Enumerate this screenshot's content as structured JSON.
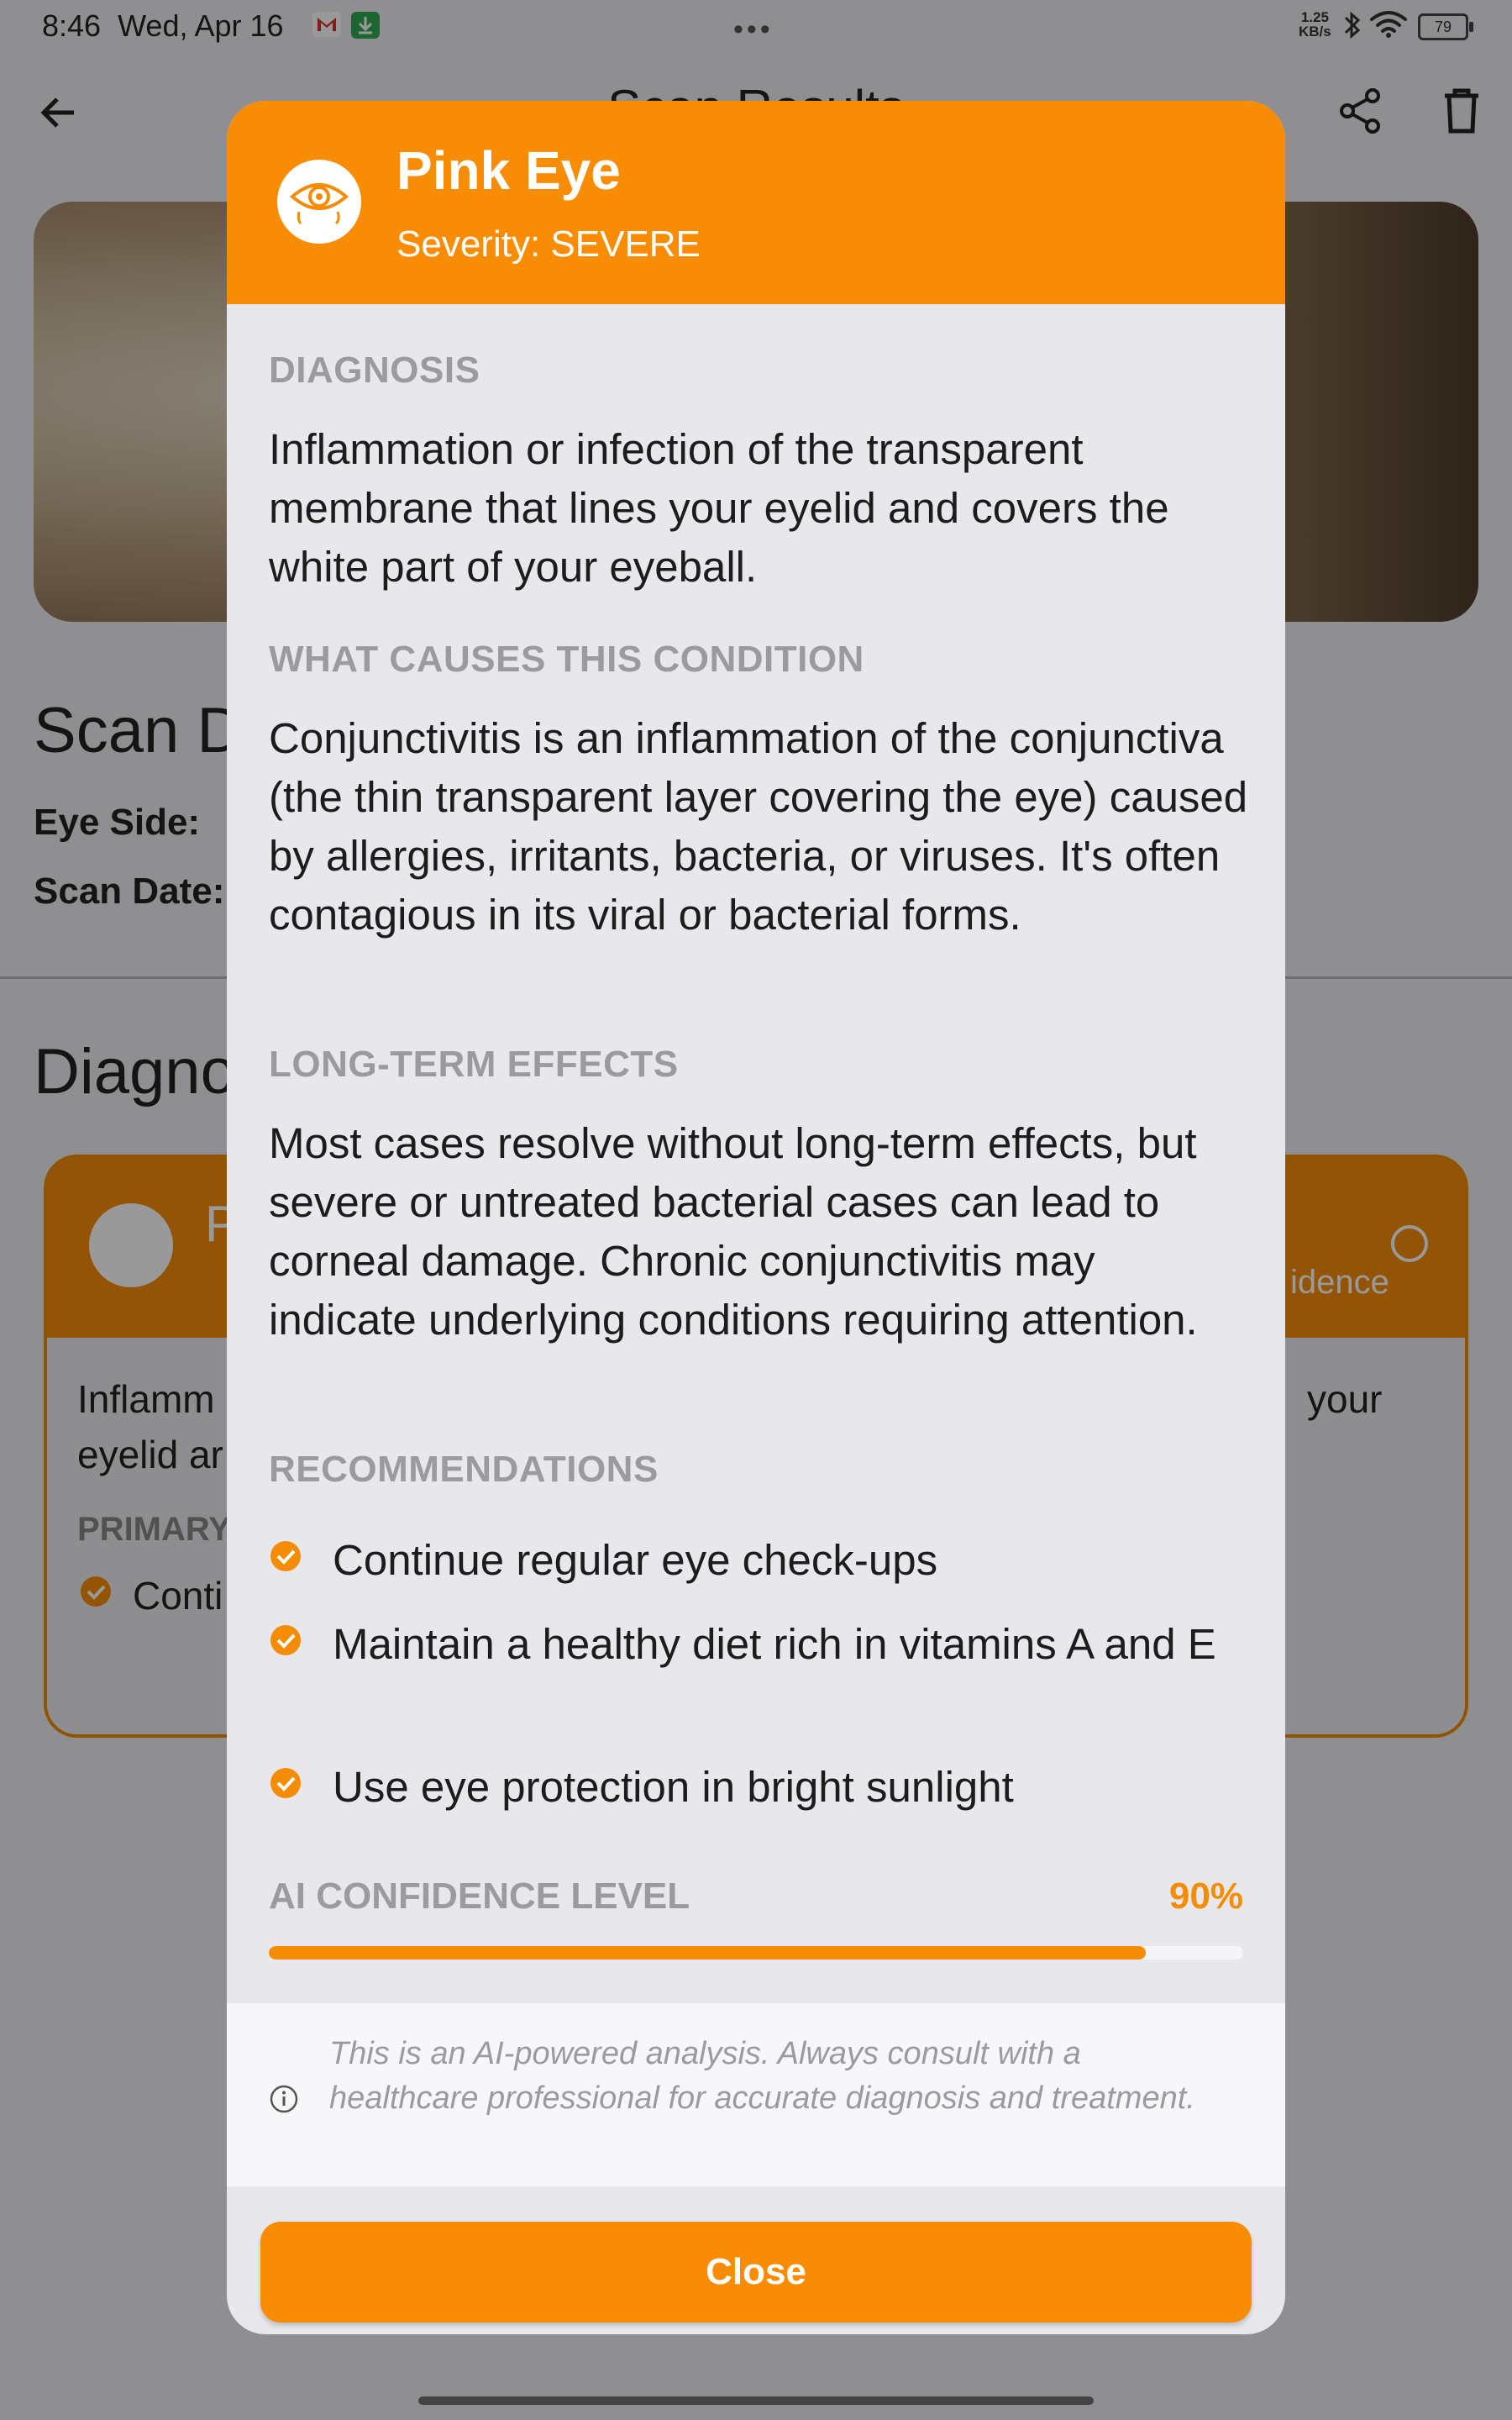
{
  "status_bar": {
    "time": "8:46",
    "date": "Wed, Apr 16",
    "network_speed_value": "1.25",
    "network_speed_unit": "KB/s",
    "battery": "79",
    "icons": [
      "gmail-icon",
      "download-icon",
      "bluetooth-icon",
      "wifi-icon",
      "battery-icon"
    ]
  },
  "app_bar": {
    "title": "Scan Results",
    "icons": [
      "back-arrow-icon",
      "share-icon",
      "delete-icon"
    ]
  },
  "background": {
    "details_title": "Scan D",
    "eye_side_label": "Eye Side:",
    "scan_date_label": "Scan Date:",
    "diagnosis_title": "Diagno",
    "card_letter": "P",
    "card_confidence_fragment": "idence",
    "card_text_left_1": "Inflamm",
    "card_text_left_2": "eyelid ar",
    "card_text_right": "your",
    "card_primary_label": "PRIMARY",
    "card_primary_item": "Conti"
  },
  "dialog": {
    "title": "Pink Eye",
    "severity": "Severity: SEVERE",
    "sections": {
      "diagnosis_heading": "DIAGNOSIS",
      "diagnosis_text": "Inflammation or infection of the transparent membrane that lines your eyelid and covers the white part of your eyeball.",
      "causes_heading": "WHAT CAUSES THIS CONDITION",
      "causes_text": "Conjunctivitis is an inflammation of the conjunctiva (the thin transparent layer covering the eye) caused by allergies, irritants, bacteria, or viruses. It's often contagious in its viral or bacterial forms.",
      "effects_heading": "LONG-TERM EFFECTS",
      "effects_text": "Most cases resolve without long-term effects, but severe or untreated bacterial cases can lead to corneal damage. Chronic conjunctivitis may indicate underlying conditions requiring attention.",
      "recommendations_heading": "RECOMMENDATIONS",
      "recommendations": [
        "Continue regular eye check-ups",
        "Maintain a healthy diet rich in vitamins A and E",
        "Use eye protection in bright sunlight"
      ]
    },
    "confidence": {
      "label": "AI CONFIDENCE LEVEL",
      "value_text": "90%",
      "value": 0.9
    },
    "disclaimer": "This is an AI-powered analysis. Always consult with a healthcare professional for accurate diagnosis and treatment.",
    "close_label": "Close"
  },
  "colors": {
    "accent": "#F88C05",
    "muted_heading": "#9A9AA0",
    "dialog_background": "#E8E8EC"
  }
}
